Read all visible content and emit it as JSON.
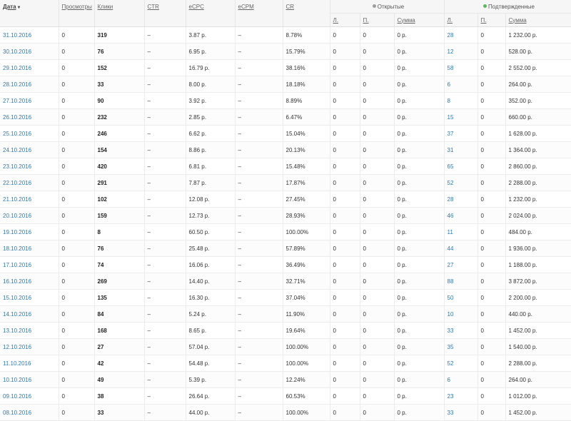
{
  "header": {
    "date": "Дата",
    "views": "Просмотры",
    "clicks": "Клики",
    "ctr": "CTR",
    "ecpc": "eCPC",
    "ecpm": "eCPM",
    "cr": "CR",
    "group_open": "Открытые",
    "group_confirmed": "Подтвержденные",
    "sub_l": "Л.",
    "sub_p": "П.",
    "sub_sum": "Сумма"
  },
  "icons": {
    "sort": "sort-down-icon",
    "open_dot_color": "#9e9e9e",
    "confirmed_dot_color": "#5cb85c"
  },
  "colors": {
    "link": "#2a7ab8",
    "header_bg": "#f6f6f6"
  },
  "rows": [
    {
      "date": "31.10.2016",
      "views": "0",
      "clicks": "319",
      "ctr": "–",
      "ecpc": "3.87 р.",
      "ecpm": "–",
      "cr": "8.78%",
      "o_l": "0",
      "o_p": "0",
      "o_sum": "0 р.",
      "c_l": "28",
      "c_p": "0",
      "c_sum": "1 232.00 р."
    },
    {
      "date": "30.10.2016",
      "views": "0",
      "clicks": "76",
      "ctr": "–",
      "ecpc": "6.95 р.",
      "ecpm": "–",
      "cr": "15.79%",
      "o_l": "0",
      "o_p": "0",
      "o_sum": "0 р.",
      "c_l": "12",
      "c_p": "0",
      "c_sum": "528.00 р."
    },
    {
      "date": "29.10.2016",
      "views": "0",
      "clicks": "152",
      "ctr": "–",
      "ecpc": "16.79 р.",
      "ecpm": "–",
      "cr": "38.16%",
      "o_l": "0",
      "o_p": "0",
      "o_sum": "0 р.",
      "c_l": "58",
      "c_p": "0",
      "c_sum": "2 552.00 р."
    },
    {
      "date": "28.10.2016",
      "views": "0",
      "clicks": "33",
      "ctr": "–",
      "ecpc": "8.00 р.",
      "ecpm": "–",
      "cr": "18.18%",
      "o_l": "0",
      "o_p": "0",
      "o_sum": "0 р.",
      "c_l": "6",
      "c_p": "0",
      "c_sum": "264.00 р."
    },
    {
      "date": "27.10.2016",
      "views": "0",
      "clicks": "90",
      "ctr": "–",
      "ecpc": "3.92 р.",
      "ecpm": "–",
      "cr": "8.89%",
      "o_l": "0",
      "o_p": "0",
      "o_sum": "0 р.",
      "c_l": "8",
      "c_p": "0",
      "c_sum": "352.00 р."
    },
    {
      "date": "26.10.2016",
      "views": "0",
      "clicks": "232",
      "ctr": "–",
      "ecpc": "2.85 р.",
      "ecpm": "–",
      "cr": "6.47%",
      "o_l": "0",
      "o_p": "0",
      "o_sum": "0 р.",
      "c_l": "15",
      "c_p": "0",
      "c_sum": "660.00 р."
    },
    {
      "date": "25.10.2016",
      "views": "0",
      "clicks": "246",
      "ctr": "–",
      "ecpc": "6.62 р.",
      "ecpm": "–",
      "cr": "15.04%",
      "o_l": "0",
      "o_p": "0",
      "o_sum": "0 р.",
      "c_l": "37",
      "c_p": "0",
      "c_sum": "1 628.00 р."
    },
    {
      "date": "24.10.2016",
      "views": "0",
      "clicks": "154",
      "ctr": "–",
      "ecpc": "8.86 р.",
      "ecpm": "–",
      "cr": "20.13%",
      "o_l": "0",
      "o_p": "0",
      "o_sum": "0 р.",
      "c_l": "31",
      "c_p": "0",
      "c_sum": "1 364.00 р."
    },
    {
      "date": "23.10.2016",
      "views": "0",
      "clicks": "420",
      "ctr": "–",
      "ecpc": "6.81 р.",
      "ecpm": "–",
      "cr": "15.48%",
      "o_l": "0",
      "o_p": "0",
      "o_sum": "0 р.",
      "c_l": "65",
      "c_p": "0",
      "c_sum": "2 860.00 р."
    },
    {
      "date": "22.10.2016",
      "views": "0",
      "clicks": "291",
      "ctr": "–",
      "ecpc": "7.87 р.",
      "ecpm": "–",
      "cr": "17.87%",
      "o_l": "0",
      "o_p": "0",
      "o_sum": "0 р.",
      "c_l": "52",
      "c_p": "0",
      "c_sum": "2 288.00 р."
    },
    {
      "date": "21.10.2016",
      "views": "0",
      "clicks": "102",
      "ctr": "–",
      "ecpc": "12.08 р.",
      "ecpm": "–",
      "cr": "27.45%",
      "o_l": "0",
      "o_p": "0",
      "o_sum": "0 р.",
      "c_l": "28",
      "c_p": "0",
      "c_sum": "1 232.00 р."
    },
    {
      "date": "20.10.2016",
      "views": "0",
      "clicks": "159",
      "ctr": "–",
      "ecpc": "12.73 р.",
      "ecpm": "–",
      "cr": "28.93%",
      "o_l": "0",
      "o_p": "0",
      "o_sum": "0 р.",
      "c_l": "46",
      "c_p": "0",
      "c_sum": "2 024.00 р."
    },
    {
      "date": "19.10.2016",
      "views": "0",
      "clicks": "8",
      "ctr": "–",
      "ecpc": "60.50 р.",
      "ecpm": "–",
      "cr": "100.00%",
      "o_l": "0",
      "o_p": "0",
      "o_sum": "0 р.",
      "c_l": "11",
      "c_p": "0",
      "c_sum": "484.00 р."
    },
    {
      "date": "18.10.2016",
      "views": "0",
      "clicks": "76",
      "ctr": "–",
      "ecpc": "25.48 р.",
      "ecpm": "–",
      "cr": "57.89%",
      "o_l": "0",
      "o_p": "0",
      "o_sum": "0 р.",
      "c_l": "44",
      "c_p": "0",
      "c_sum": "1 936.00 р."
    },
    {
      "date": "17.10.2016",
      "views": "0",
      "clicks": "74",
      "ctr": "–",
      "ecpc": "16.06 р.",
      "ecpm": "–",
      "cr": "36.49%",
      "o_l": "0",
      "o_p": "0",
      "o_sum": "0 р.",
      "c_l": "27",
      "c_p": "0",
      "c_sum": "1 188.00 р."
    },
    {
      "date": "16.10.2016",
      "views": "0",
      "clicks": "269",
      "ctr": "–",
      "ecpc": "14.40 р.",
      "ecpm": "–",
      "cr": "32.71%",
      "o_l": "0",
      "o_p": "0",
      "o_sum": "0 р.",
      "c_l": "88",
      "c_p": "0",
      "c_sum": "3 872.00 р."
    },
    {
      "date": "15.10.2016",
      "views": "0",
      "clicks": "135",
      "ctr": "–",
      "ecpc": "16.30 р.",
      "ecpm": "–",
      "cr": "37.04%",
      "o_l": "0",
      "o_p": "0",
      "o_sum": "0 р.",
      "c_l": "50",
      "c_p": "0",
      "c_sum": "2 200.00 р."
    },
    {
      "date": "14.10.2016",
      "views": "0",
      "clicks": "84",
      "ctr": "–",
      "ecpc": "5.24 р.",
      "ecpm": "–",
      "cr": "11.90%",
      "o_l": "0",
      "o_p": "0",
      "o_sum": "0 р.",
      "c_l": "10",
      "c_p": "0",
      "c_sum": "440.00 р."
    },
    {
      "date": "13.10.2016",
      "views": "0",
      "clicks": "168",
      "ctr": "–",
      "ecpc": "8.65 р.",
      "ecpm": "–",
      "cr": "19.64%",
      "o_l": "0",
      "o_p": "0",
      "o_sum": "0 р.",
      "c_l": "33",
      "c_p": "0",
      "c_sum": "1 452.00 р."
    },
    {
      "date": "12.10.2016",
      "views": "0",
      "clicks": "27",
      "ctr": "–",
      "ecpc": "57.04 р.",
      "ecpm": "–",
      "cr": "100.00%",
      "o_l": "0",
      "o_p": "0",
      "o_sum": "0 р.",
      "c_l": "35",
      "c_p": "0",
      "c_sum": "1 540.00 р."
    },
    {
      "date": "11.10.2016",
      "views": "0",
      "clicks": "42",
      "ctr": "–",
      "ecpc": "54.48 р.",
      "ecpm": "–",
      "cr": "100.00%",
      "o_l": "0",
      "o_p": "0",
      "o_sum": "0 р.",
      "c_l": "52",
      "c_p": "0",
      "c_sum": "2 288.00 р."
    },
    {
      "date": "10.10.2016",
      "views": "0",
      "clicks": "49",
      "ctr": "–",
      "ecpc": "5.39 р.",
      "ecpm": "–",
      "cr": "12.24%",
      "o_l": "0",
      "o_p": "0",
      "o_sum": "0 р.",
      "c_l": "6",
      "c_p": "0",
      "c_sum": "264.00 р."
    },
    {
      "date": "09.10.2016",
      "views": "0",
      "clicks": "38",
      "ctr": "–",
      "ecpc": "26.64 р.",
      "ecpm": "–",
      "cr": "60.53%",
      "o_l": "0",
      "o_p": "0",
      "o_sum": "0 р.",
      "c_l": "23",
      "c_p": "0",
      "c_sum": "1 012.00 р."
    },
    {
      "date": "08.10.2016",
      "views": "0",
      "clicks": "33",
      "ctr": "–",
      "ecpc": "44.00 р.",
      "ecpm": "–",
      "cr": "100.00%",
      "o_l": "0",
      "o_p": "0",
      "o_sum": "0 р.",
      "c_l": "33",
      "c_p": "0",
      "c_sum": "1 452.00 р."
    }
  ]
}
